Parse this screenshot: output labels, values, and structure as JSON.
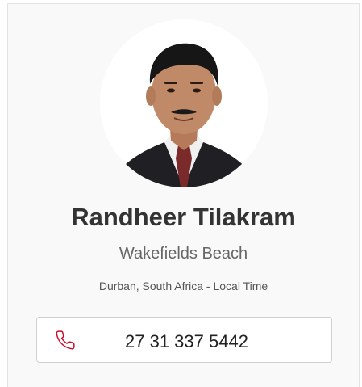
{
  "agent": {
    "name": "Randheer Tilakram",
    "company": "Wakefields Beach",
    "location": "Durban, South Africa - Local Time",
    "phone": "27 31 337 5442"
  },
  "icons": {
    "phone": "phone-icon",
    "photo": "profile-photo"
  },
  "colors": {
    "accent": "#c8102e",
    "card_background": "#f9f9f9",
    "name_text": "#333333"
  }
}
